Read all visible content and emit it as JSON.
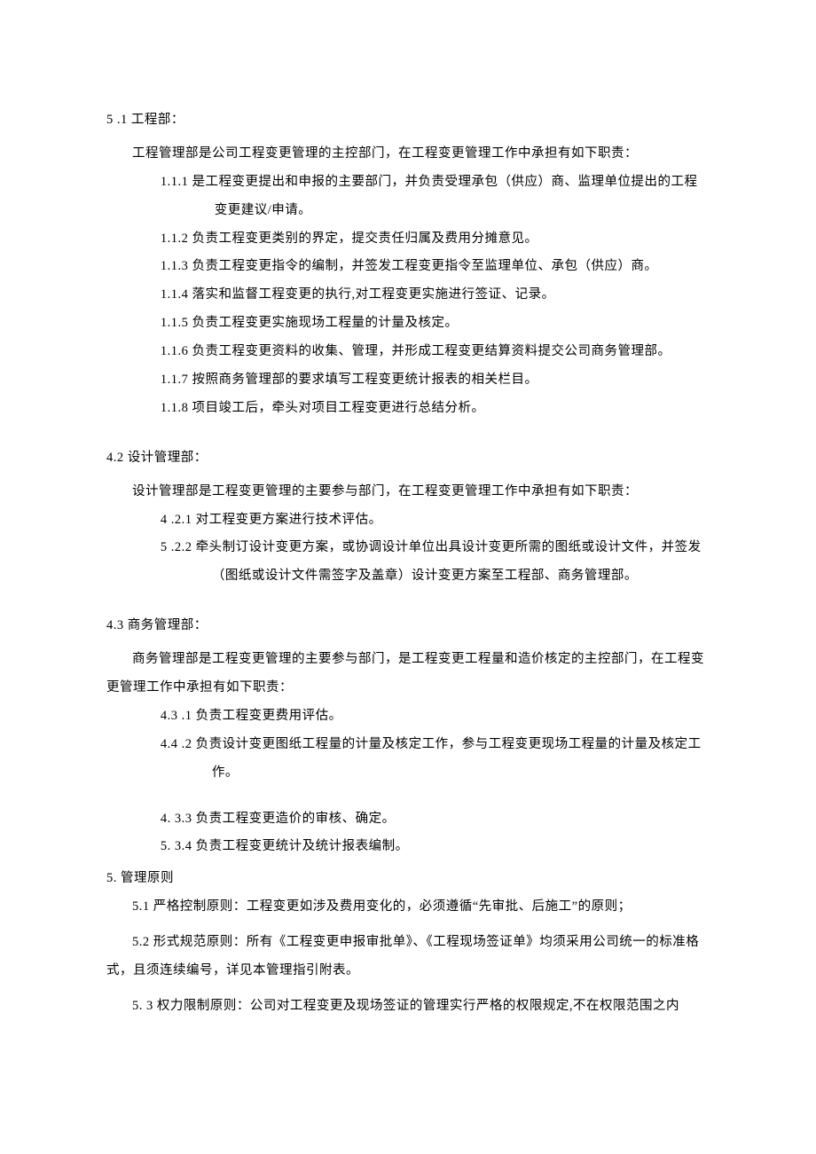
{
  "s5_1": {
    "num": "5",
    "title": " .1 工程部：",
    "intro": "工程管理部是公司工程变更管理的主控部门，在工程变更管理工作中承担有如下职责：",
    "items": [
      {
        "num": "1.1.1  ",
        "text": "是工程变更提出和申报的主要部门，并负责受理承包（供应）商、监理单位提出的工程变更建议/申请。"
      },
      {
        "num": "1.1.2  ",
        "text": "负责工程变更类别的界定，提交责任归属及费用分摊意见。"
      },
      {
        "num": "1.1.3  ",
        "text": "负责工程变更指令的编制，并签发工程变更指令至监理单位、承包（供应）商。"
      },
      {
        "num": "1.1.4  ",
        "text": "落实和监督工程变更的执行,对工程变更实施进行签证、记录。"
      },
      {
        "num": "1.1.5  ",
        "text": "负责工程变更实施现场工程量的计量及核定。"
      },
      {
        "num": "1.1.6  ",
        "text": "负责工程变更资料的收集、管理，并形成工程变更结算资料提交公司商务管理部。"
      },
      {
        "num": "1.1.7  ",
        "text": "按照商务管理部的要求填写工程变更统计报表的相关栏目。"
      },
      {
        "num": "1.1.8  ",
        "text": "项目竣工后，牵头对项目工程变更进行总结分析。"
      }
    ]
  },
  "s4_2": {
    "num": "4.2",
    "title": "    设计管理部：",
    "intro": "设计管理部是工程变更管理的主要参与部门，在工程变更管理工作中承担有如下职责：",
    "items": [
      {
        "num": "4   ",
        "text": ".2.1 对工程变更方案进行技术评估。"
      },
      {
        "num": "5   ",
        "text": ".2.2 牵头制订设计变更方案，或协调设计单位出具设计变更所需的图纸或设计文件，并签发（图纸或设计文件需签字及盖章）设计变更方案至工程部、商务管理部。"
      }
    ]
  },
  "s4_3": {
    "num": "4.3",
    "title": "    商务管理部：",
    "intro": "商务管理部是工程变更管理的主要参与部门，是工程变更工程量和造价核定的主控部门，在工程变更管理工作中承担有如下职责：",
    "items": [
      {
        "num": "4.3  ",
        "text": ".1 负责工程变更费用评估。"
      },
      {
        "num": "4.4  ",
        "text": ".2 负责设计变更图纸工程量的计量及核定工作，参与工程变更现场工程量的计量及核定工作。"
      },
      {
        "num": "4.  ",
        "text": "3.3 负责工程变更造价的审核、确定。"
      },
      {
        "num": "5.  ",
        "text": "3.4 负责工程变更统计及统计报表编制。"
      }
    ]
  },
  "s5": {
    "num": "5.",
    "title": " 管理原则",
    "items": [
      {
        "num": "5.1  ",
        "text": "严格控制原则：工程变更如涉及费用变化的，必须遵循“先审批、后施工”的原则；"
      },
      {
        "num": "5.2  ",
        "text": "形式规范原则：所有《工程变更申报审批单》、《工程现场签证单》均须采用公司统一的标准格式，且须连续编号，详见本管理指引附表。"
      },
      {
        "num": "5.  ",
        "text": "3 权力限制原则：公司对工程变更及现场签证的管理实行严格的权限规定,不在权限范围之内"
      }
    ]
  }
}
